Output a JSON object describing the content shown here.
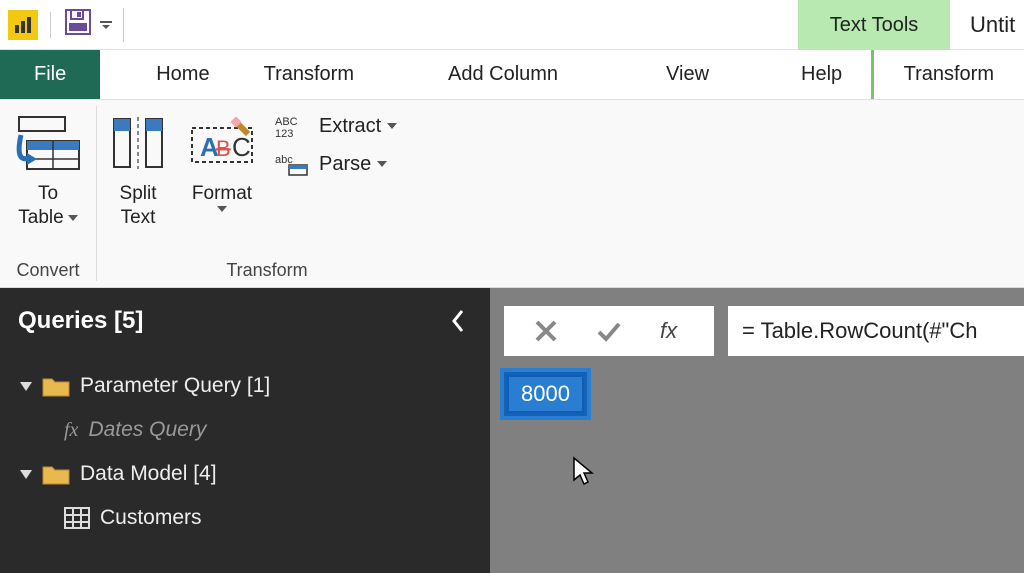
{
  "titlebar": {
    "context_tab": "Text Tools",
    "doc_title": "Untit"
  },
  "tabs": {
    "file": "File",
    "home": "Home",
    "transform": "Transform",
    "add_column": "Add Column",
    "view": "View",
    "help": "Help",
    "transform2": "Transform"
  },
  "ribbon": {
    "convert": {
      "to_table_line1": "To",
      "to_table_line2": "Table",
      "group_label": "Convert"
    },
    "transform": {
      "split_line1": "Split",
      "split_line2": "Text",
      "format_line1": "Format",
      "extract": "Extract",
      "parse": "Parse",
      "group_label": "Transform"
    }
  },
  "queries": {
    "header": "Queries [5]",
    "folder_param": "Parameter Query [1]",
    "dates_query": "Dates Query",
    "folder_model": "Data Model [4]",
    "customers": "Customers"
  },
  "formula": {
    "text": "= Table.RowCount(#\"Ch"
  },
  "result": {
    "value": "8000"
  }
}
